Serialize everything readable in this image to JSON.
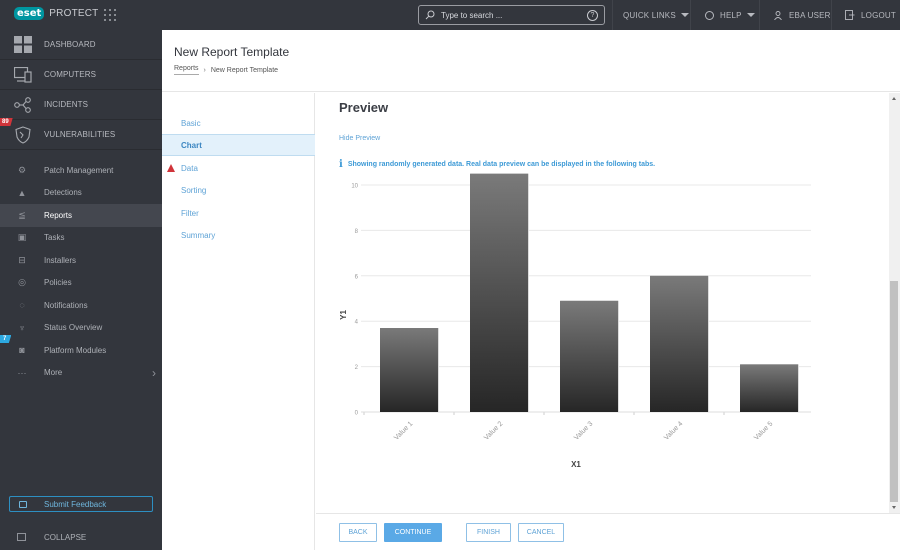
{
  "topbar": {
    "logo_badge": "eset",
    "product": "PROTECT",
    "search_placeholder": "Type to search ...",
    "help_glyph": "?",
    "quick_links": "QUICK LINKS",
    "help": "HELP",
    "user": "EBA USER",
    "logout": "LOGOUT"
  },
  "sidebar": {
    "main": [
      {
        "label": "DASHBOARD",
        "icon": "dashboard-icon"
      },
      {
        "label": "COMPUTERS",
        "icon": "computers-icon"
      },
      {
        "label": "INCIDENTS",
        "icon": "incidents-icon"
      },
      {
        "label": "VULNERABILITIES",
        "icon": "shield-icon",
        "badge": "89"
      }
    ],
    "sub": [
      {
        "label": "Patch Management",
        "icon": "patch-icon"
      },
      {
        "label": "Detections",
        "icon": "warning-icon"
      },
      {
        "label": "Reports",
        "icon": "reports-icon",
        "active": true
      },
      {
        "label": "Tasks",
        "icon": "tasks-icon"
      },
      {
        "label": "Installers",
        "icon": "installers-icon"
      },
      {
        "label": "Policies",
        "icon": "policies-icon"
      },
      {
        "label": "Notifications",
        "icon": "notifications-icon"
      },
      {
        "label": "Status Overview",
        "icon": "status-icon"
      },
      {
        "label": "Platform Modules",
        "icon": "modules-icon",
        "badge": "7"
      },
      {
        "label": "More",
        "icon": "more-icon"
      }
    ],
    "feedback": "Submit Feedback",
    "collapse": "COLLAPSE"
  },
  "header": {
    "title": "New Report Template",
    "breadcrumb": [
      "Reports",
      "New Report Template"
    ]
  },
  "steps": [
    {
      "label": "Basic"
    },
    {
      "label": "Chart",
      "active": true
    },
    {
      "label": "Data",
      "warning": true
    },
    {
      "label": "Sorting"
    },
    {
      "label": "Filter"
    },
    {
      "label": "Summary"
    }
  ],
  "preview": {
    "title": "Preview",
    "hide_link": "Hide Preview",
    "info_glyph": "i",
    "info": "Showing randomly generated data. Real data preview can be displayed in the following tabs."
  },
  "chart_data": {
    "type": "bar",
    "title": "",
    "xlabel": "X1",
    "ylabel": "Y1",
    "categories": [
      "Value 1",
      "Value 2",
      "Value 3",
      "Value 4",
      "Value 5"
    ],
    "values": [
      3.7,
      10.5,
      4.9,
      6.0,
      2.1
    ],
    "ylim": [
      0,
      10.5
    ],
    "yticks": [
      0,
      2,
      4,
      6,
      8,
      10
    ],
    "grid": true,
    "legend": "none",
    "bar_color": "#555555"
  },
  "footer": {
    "back": "BACK",
    "continue": "CONTINUE",
    "finish": "FINISH",
    "cancel": "CANCEL"
  }
}
